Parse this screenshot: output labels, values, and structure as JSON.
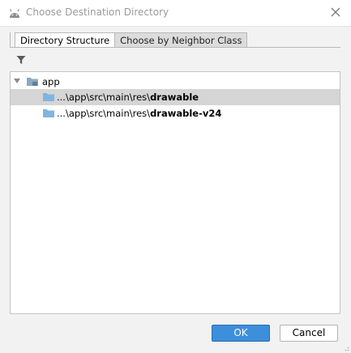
{
  "window": {
    "title": "Choose Destination Directory",
    "app_icon": "android-icon",
    "close_icon": "close-icon"
  },
  "tabs": [
    {
      "label": "Directory Structure",
      "active": true
    },
    {
      "label": "Choose by Neighbor Class",
      "active": false
    }
  ],
  "toolbar": {
    "filter_icon": "filter-icon"
  },
  "tree": {
    "root": {
      "label": "app",
      "expanded": true,
      "icon": "module-folder-icon"
    },
    "children": [
      {
        "prefix": "...\\app\\src\\main\\res\\",
        "name": "drawable",
        "selected": true,
        "icon": "folder-icon"
      },
      {
        "prefix": "...\\app\\src\\main\\res\\",
        "name": "drawable-v24",
        "selected": false,
        "icon": "folder-icon"
      }
    ]
  },
  "buttons": {
    "ok_label": "OK",
    "cancel_label": "Cancel"
  },
  "colors": {
    "primary_button": "#3d8edb",
    "selection": "#d5d5d5",
    "folder": "#7fb5e0",
    "android_green": "#a4c639"
  }
}
